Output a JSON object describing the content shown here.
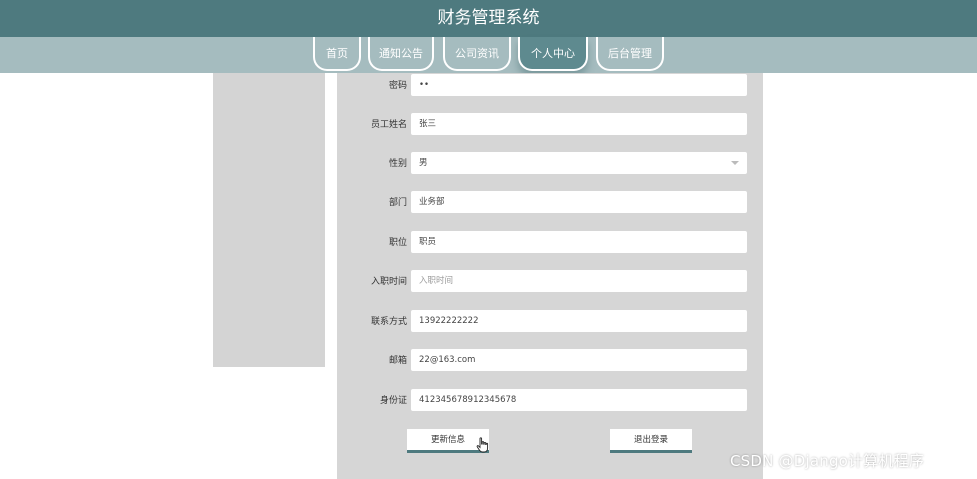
{
  "header": {
    "title": "财务管理系统"
  },
  "nav": {
    "tabs": [
      {
        "label": "首页"
      },
      {
        "label": "通知公告"
      },
      {
        "label": "公司资讯"
      },
      {
        "label": "个人中心"
      },
      {
        "label": "后台管理"
      }
    ],
    "active_index": 3
  },
  "form": {
    "fields": [
      {
        "label": "密码",
        "value": "••"
      },
      {
        "label": "员工姓名",
        "value": "张三"
      },
      {
        "label": "性别",
        "value": "男"
      },
      {
        "label": "部门",
        "value": "业务部"
      },
      {
        "label": "职位",
        "value": "职员"
      },
      {
        "label": "入职时间",
        "placeholder": "入职时间"
      },
      {
        "label": "联系方式",
        "value": "13922222222"
      },
      {
        "label": "邮箱",
        "value": "22@163.com"
      },
      {
        "label": "身份证",
        "value": "412345678912345678"
      }
    ],
    "update_button": "更新信息",
    "logout_button": "退出登录"
  },
  "watermark": "CSDN @Django计算机程序",
  "colors": {
    "header": "#4e7a7f",
    "navbar": "#a5bcbf",
    "active_tab": "#5e8a8f",
    "panel": "#d6d6d6"
  }
}
